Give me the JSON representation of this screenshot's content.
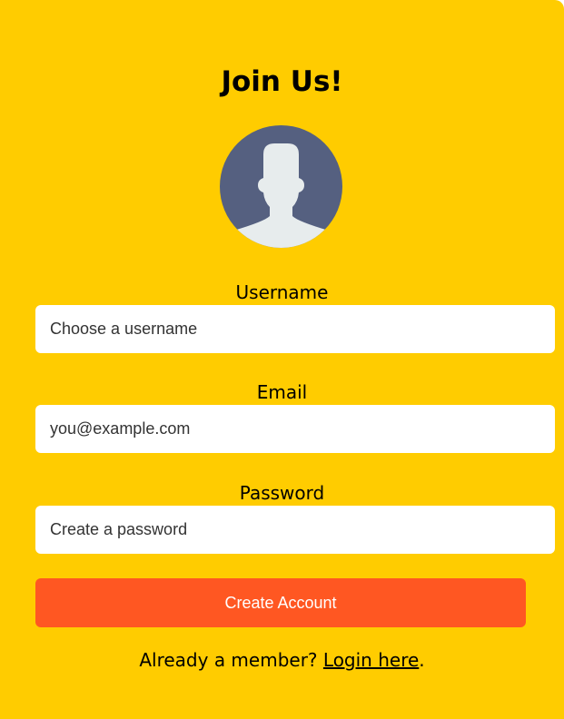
{
  "form": {
    "title": "Join Us!",
    "avatar_icon": "user-avatar-icon",
    "username": {
      "label": "Username",
      "value": "",
      "placeholder": "Choose a username"
    },
    "email": {
      "label": "Email",
      "value": "",
      "placeholder": "you@example.com"
    },
    "password": {
      "label": "Password",
      "value": "",
      "placeholder": "Create a password"
    },
    "submit_label": "Create Account",
    "footer_text": "Already a member? ",
    "login_link_label": "Login here",
    "footer_end": "."
  },
  "colors": {
    "background": "#ffcc00",
    "button": "#ff5722",
    "avatar_circle": "#556080",
    "avatar_figure": "#e7eced"
  }
}
